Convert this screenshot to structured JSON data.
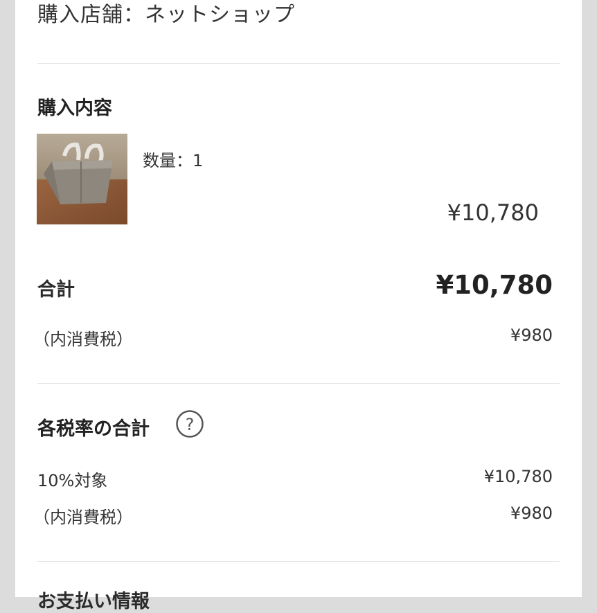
{
  "store": {
    "label": "購入店舗：",
    "value": "ネットショップ"
  },
  "purchase": {
    "heading": "購入内容",
    "item": {
      "quantity_label": "数量：",
      "quantity": "1",
      "price": "¥10,780",
      "image_icon": "product-bag-photo"
    }
  },
  "totals": {
    "total_label": "合計",
    "total_value": "¥10,780",
    "tax_label": "（内消費税）",
    "tax_value": "¥980"
  },
  "tax_rates": {
    "heading": "各税率の合計",
    "help_icon": "question-circle-icon",
    "rows": [
      {
        "label": "10%対象",
        "value": "¥10,780"
      },
      {
        "label": "（内消費税）",
        "value": "¥980"
      }
    ]
  },
  "payment": {
    "heading": "お支払い情報"
  }
}
